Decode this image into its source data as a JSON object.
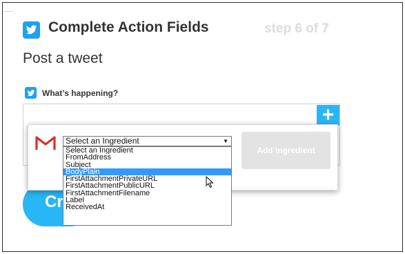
{
  "header": {
    "title": "Complete Action Fields",
    "step": "step 6 of 7"
  },
  "action": {
    "subtitle": "Post a tweet"
  },
  "field": {
    "label": "What’s happening?"
  },
  "tweet_box": {
    "plus_label": "+"
  },
  "cta": {
    "label_visible": "Cr"
  },
  "ingredient_picker": {
    "selected": "Select an Ingredient",
    "add_button": "Add Ingredient",
    "options": [
      "Select an Ingredient",
      "FromAddress",
      "Subject",
      "BodyPlain",
      "FirstAttachmentPrivateURL",
      "FirstAttachmentPublicURL",
      "FirstAttachmentFilename",
      "Label",
      "ReceivedAt"
    ],
    "highlighted_option": "BodyPlain"
  },
  "icons": {
    "header": "twitter-icon",
    "field": "twitter-icon",
    "ingredient_service": "gmail-icon",
    "pointer": "mouse-cursor-icon"
  },
  "colors": {
    "twitter_blue": "#1da1f2",
    "accent_blue": "#29b6f6",
    "highlight": "#3399ff",
    "muted_step": "#dcdcdc",
    "gmail_red": "#d93025"
  }
}
